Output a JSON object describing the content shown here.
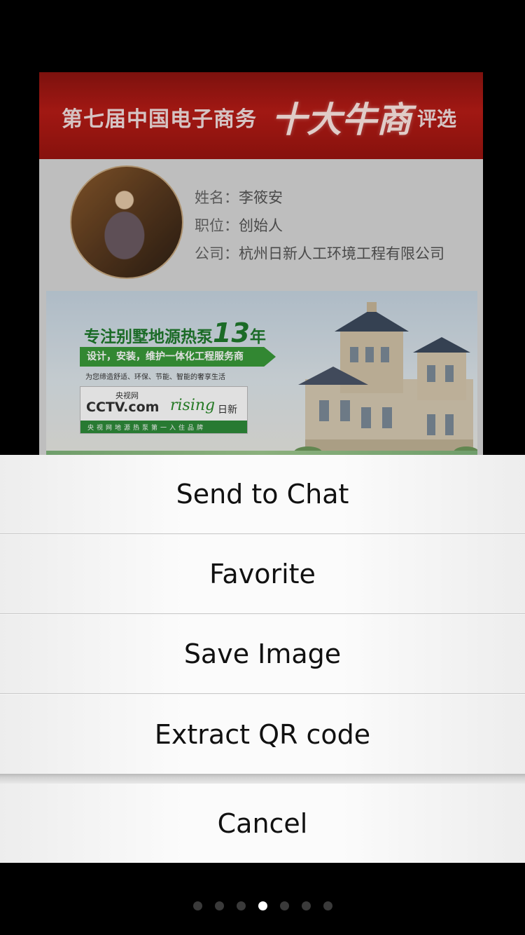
{
  "image_card": {
    "banner": {
      "prefix": "第七届中国电子商务",
      "highlight": "十大牛商",
      "suffix": "评选"
    },
    "profile": {
      "name_label": "姓名：",
      "name_value": "李筱安",
      "title_label": "职位：",
      "title_value": "创始人",
      "company_label": "公司：",
      "company_value": "杭州日新人工环境工程有限公司"
    },
    "ad": {
      "headline": "专注别墅地源热泵",
      "headline_number": "13",
      "headline_unit": "年",
      "strip": "设计，安装，维护一体化工程服务商",
      "small": "为您缔造舒适、环保、节能、智能的奢享生活",
      "cctv": "CCTV.com",
      "cctv_cn": "央视网",
      "rising": "rising",
      "rising_cn": "日新",
      "bar": "央视网地源热泵第一入住品牌"
    }
  },
  "action_sheet": {
    "items": [
      {
        "label": "Send to Chat"
      },
      {
        "label": "Favorite"
      },
      {
        "label": "Save Image"
      },
      {
        "label": "Extract QR code"
      }
    ],
    "cancel_label": "Cancel"
  },
  "page_indicator": {
    "total": 7,
    "active_index": 3
  },
  "colors": {
    "banner_red": "#b81c16",
    "ad_green": "#2e8b3a",
    "sheet_bg": "#fbfbfb",
    "dot_active": "#ffffff",
    "dot_inactive": "#3a3a3a"
  }
}
